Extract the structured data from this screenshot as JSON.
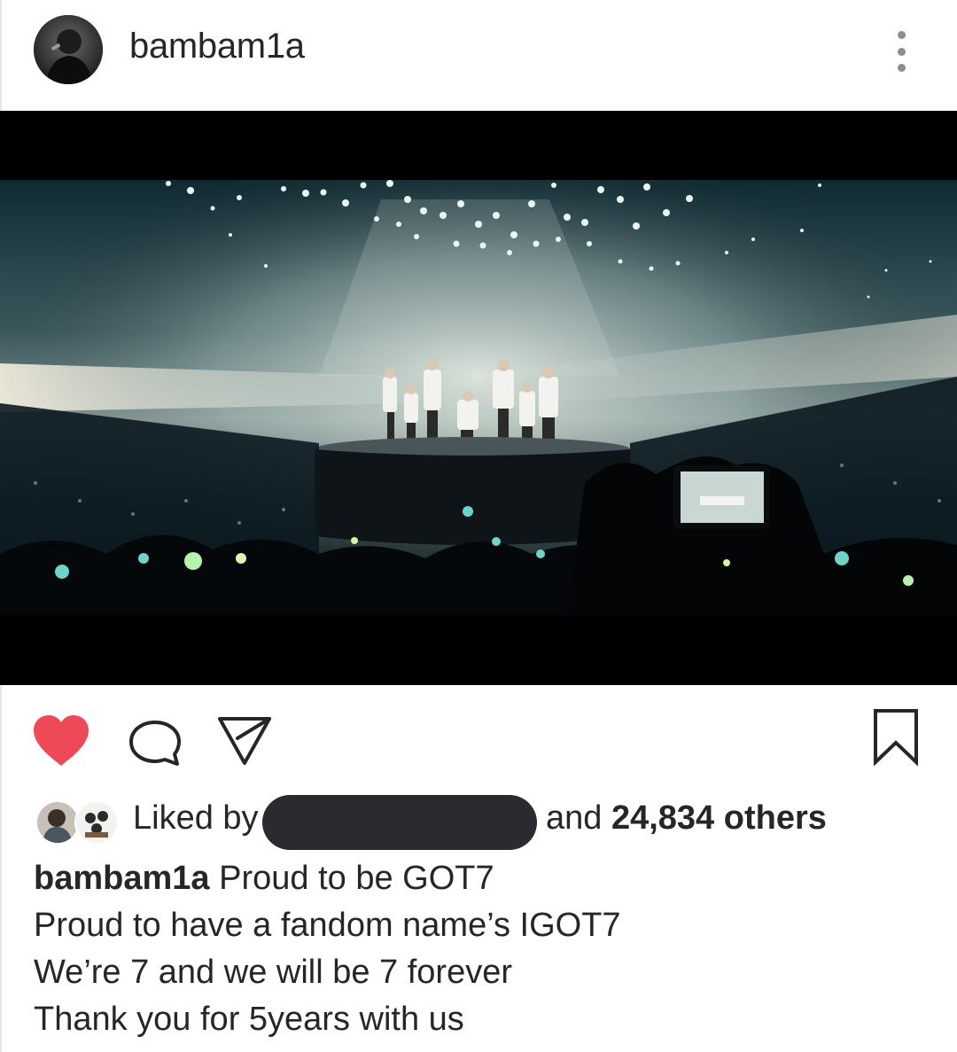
{
  "post": {
    "username": "bambam1a",
    "liked_by_prefix": "Liked by",
    "liked_and": "and",
    "liked_count": "24,834 others",
    "caption_user": "bambam1a",
    "caption_lines": [
      "Proud to be GOT7",
      "Proud to have a fandom name’s IGOT7",
      "We’re 7 and we will be 7 forever",
      "Thank you for 5years with us"
    ]
  },
  "icons": {
    "more": "more-vertical-icon",
    "like": "heart-icon",
    "comment": "comment-icon",
    "share": "send-icon",
    "save": "bookmark-icon"
  },
  "colors": {
    "like_red": "#ed4956",
    "text": "#262626",
    "muted": "#8e8e8e"
  }
}
